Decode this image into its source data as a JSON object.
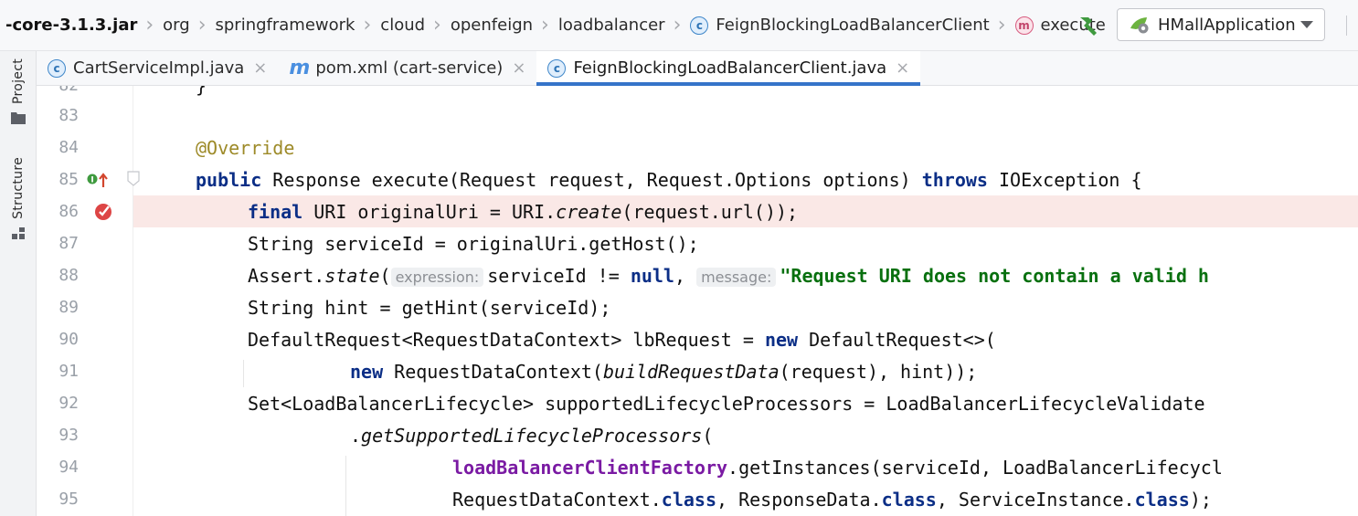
{
  "breadcrumbs": [
    {
      "label": "-core-3.1.3.jar",
      "bold": true
    },
    {
      "label": "org"
    },
    {
      "label": "springframework"
    },
    {
      "label": "cloud"
    },
    {
      "label": "openfeign"
    },
    {
      "label": "loadbalancer"
    },
    {
      "label": "FeignBlockingLoadBalancerClient",
      "icon": "class-icon",
      "icon_text": "c"
    },
    {
      "label": "execute",
      "icon": "method-icon",
      "icon_text": "m"
    }
  ],
  "toolbar": {
    "build_icon": "hammer-icon",
    "run_config_label": "HMallApplication"
  },
  "toolwindows": [
    {
      "label": "Project",
      "icon": "folder-icon"
    },
    {
      "label": "Structure",
      "icon": "structure-icon"
    }
  ],
  "tabs": [
    {
      "label": "CartServiceImpl.java",
      "icon": "class-icon",
      "icon_text": "c",
      "close": "×",
      "active": false
    },
    {
      "label": "pom.xml (cart-service)",
      "icon": "maven-icon",
      "icon_text": "m",
      "close": "×",
      "active": false
    },
    {
      "label": "FeignBlockingLoadBalancerClient.java",
      "icon": "class-icon",
      "icon_text": "c",
      "close": "×",
      "active": true
    }
  ],
  "editor": {
    "partial_line_number": "82",
    "partial_line_code": "}",
    "lines": [
      {
        "num": "83"
      },
      {
        "num": "84"
      },
      {
        "num": "85",
        "gutter_icon": "override-implements-icon"
      },
      {
        "num": "86",
        "gutter_icon": "breakpoint-icon",
        "breakpoint": true
      },
      {
        "num": "87"
      },
      {
        "num": "88"
      },
      {
        "num": "89"
      },
      {
        "num": "90"
      },
      {
        "num": "91"
      },
      {
        "num": "92"
      },
      {
        "num": "93"
      },
      {
        "num": "94"
      },
      {
        "num": "95"
      }
    ],
    "code": {
      "l84": "@Override",
      "l85_kw1": "public",
      "l85_a": " Response execute(Request request, Request.Options options) ",
      "l85_kw2": "throws",
      "l85_b": " IOException {",
      "l86_kw": "final",
      "l86_a": " URI originalUri = URI.",
      "l86_it": "create",
      "l86_b": "(request.url());",
      "l87": "String serviceId = originalUri.getHost();",
      "l88_a": "Assert.",
      "l88_it": "state",
      "l88_b": "(",
      "l88_hint1": "expression:",
      "l88_c": "serviceId != ",
      "l88_kw": "null",
      "l88_d": ", ",
      "l88_hint2": "message:",
      "l88_str": "\"Request URI does not contain a valid h",
      "l89": "String hint = getHint(serviceId);",
      "l90_a": "DefaultRequest<RequestDataContext> lbRequest = ",
      "l90_kw": "new",
      "l90_b": " DefaultRequest<>(",
      "l91_kw": "new",
      "l91_a": " RequestDataContext(",
      "l91_it": "buildRequestData",
      "l91_b": "(request), hint));",
      "l92": "Set<LoadBalancerLifecycle> supportedLifecycleProcessors = LoadBalancerLifecycleValidate",
      "l93_a": ".",
      "l93_it": "getSupportedLifecycleProcessors",
      "l93_b": "(",
      "l94_field": "loadBalancerClientFactory",
      "l94_a": ".getInstances(serviceId, LoadBalancerLifecycl",
      "l95_a": "RequestDataContext.",
      "l95_kw1": "class",
      "l95_b": ", ResponseData.",
      "l95_kw2": "class",
      "l95_c": ", ServiceInstance.",
      "l95_kw3": "class",
      "l95_d": ");"
    }
  },
  "colors": {
    "keyword": "#0b2e86",
    "annotation": "#9d8a28",
    "string": "#08700f",
    "field": "#7a1aa3",
    "breakpoint_line_bg": "#fae8e6",
    "active_tab_underline": "#3574c9"
  }
}
